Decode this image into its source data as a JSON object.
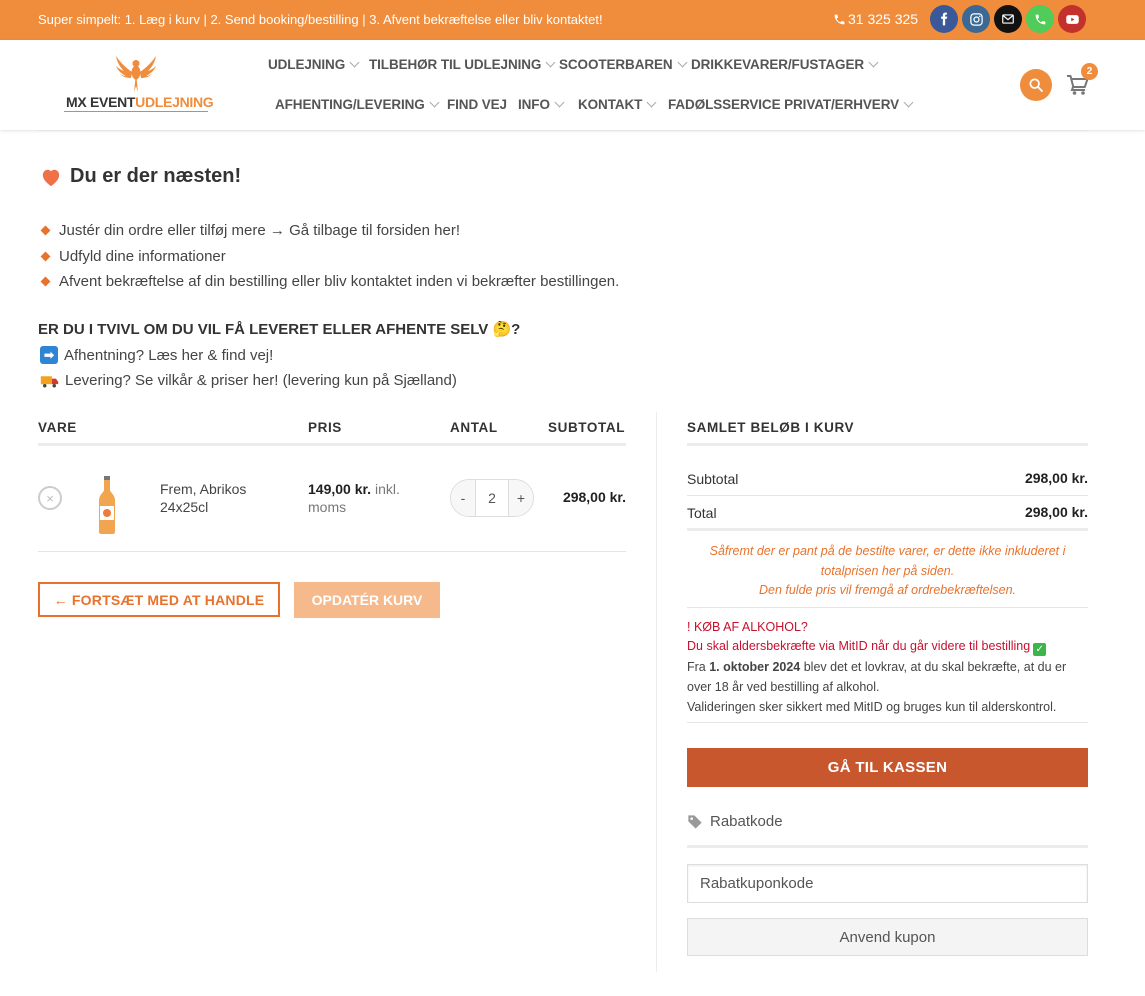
{
  "topbar": {
    "message": "Super simpelt: 1. Læg i kurv | 2. Send booking/bestilling | 3. Afvent bekræftelse eller bliv kontaktet!",
    "phone": "31 325 325",
    "social": [
      {
        "icon": "facebook-icon",
        "color": "#3b5998"
      },
      {
        "icon": "instagram-icon",
        "color": "#3b6994"
      },
      {
        "icon": "email-icon",
        "color": "#111111"
      },
      {
        "icon": "phone-icon",
        "color": "#51cb5a"
      },
      {
        "icon": "youtube-icon",
        "color": "#c4302b"
      }
    ]
  },
  "logo": {
    "part1": "MX EVENT",
    "part2": "UDLEJNING"
  },
  "nav": {
    "udlejning": "UDLEJNING",
    "tilbehor": "TILBEHØR TIL UDLEJNING",
    "scooterbaren": "SCOOTERBAREN",
    "drikkevarer": "DRIKKEVARER/FUSTAGER",
    "afhenting": "AFHENTING/LEVERING",
    "findvej": "FIND VEJ",
    "info": "INFO",
    "kontakt": "KONTAKT",
    "fadol": "FADØLSSERVICE PRIVAT/ERHVERV"
  },
  "cart_count": "2",
  "intro": {
    "title": "Du er der næsten!",
    "bullets": [
      "Justér din ordre eller tilføj mere → Gå tilbage til forsiden her!",
      "Udfyld dine informationer",
      "Afvent bekræftelse af din bestilling eller bliv kontaktet inden vi bekræfter bestillingen."
    ],
    "doubt": "ER DU I TVIVL OM DU VIL FÅ LEVERET ELLER AFHENTE SELV 🤔?",
    "pickup": "Afhentning? Læs her & find vej!",
    "delivery": "Levering? Se vilkår & priser her! (levering kun på Sjælland)"
  },
  "cart": {
    "headers": {
      "vare": "VARE",
      "pris": "PRIS",
      "antal": "ANTAL",
      "subtotal": "SUBTOTAL"
    },
    "items": [
      {
        "name": "Frem, Abrikos 24x25cl",
        "price": "149,00 kr.",
        "price_suffix": "inkl. moms",
        "qty": "2",
        "subtotal": "298,00 kr."
      }
    ],
    "remove_symbol": "×",
    "qty_minus": "-",
    "qty_plus": "+",
    "continue_label": "← FORTSÆT MED AT HANDLE",
    "update_label": "OPDATÉR KURV"
  },
  "totals": {
    "title": "SAMLET BELØB I KURV",
    "subtotal_label": "Subtotal",
    "subtotal_value": "298,00 kr.",
    "total_label": "Total",
    "total_value": "298,00 kr.",
    "pant_note_1": "Såfremt der er pant på de bestilte varer, er dette ikke inkluderet i totalprisen her på siden.",
    "pant_note_2": "Den fulde pris vil fremgå af ordrebekræftelsen.",
    "alcohol_title": "! KØB AF ALKOHOL?",
    "alcohol_mitid": "Du skal aldersbekræfte via MitID når du går videre til bestilling",
    "alcohol_text_pre": "Fra ",
    "alcohol_date": "1. oktober 2024",
    "alcohol_text_post": " blev det et lovkrav, at du skal bekræfte, at du er over 18 år ved bestilling af alkohol.",
    "alcohol_validation": "Valideringen sker sikkert med MitID og bruges kun til alderskontrol.",
    "checkout_label": "GÅ TIL KASSEN",
    "coupon_label": "Rabatkode",
    "coupon_placeholder": "Rabatkuponkode",
    "apply_label": "Anvend kupon"
  }
}
